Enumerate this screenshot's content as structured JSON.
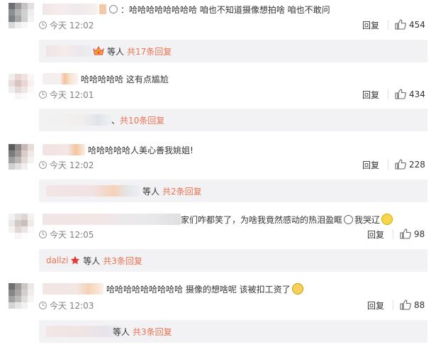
{
  "comments": [
    {
      "text": "：哈哈哈哈哈哈哈哈  咱也不知道摄像想拍啥  咱也不敢问",
      "time": "今天 12:02",
      "reply_label": "回复",
      "likes": "454",
      "sub": {
        "etc": "等人",
        "count": "共17条回复"
      }
    },
    {
      "text": "哈哈哈哈哈  这有点尴尬",
      "time": "今天 12:01",
      "reply_label": "回复",
      "likes": "434",
      "sub": {
        "etc": "、",
        "count": "共10条回复"
      }
    },
    {
      "text": "哈哈哈哈哈人美心善我姚姐!",
      "time": "今天 12:02",
      "reply_label": "回复",
      "likes": "228",
      "sub": {
        "etc": "等人",
        "count": "共2条回复"
      }
    },
    {
      "text": "家们咋都笑了，为啥我竟然感动的热泪盈眶",
      "text_tail": "我哭辽",
      "time": "今天 12:05",
      "reply_label": "回复",
      "likes": "98",
      "sub": {
        "user": "dallzi",
        "etc": "等人",
        "count": "共3条回复"
      }
    },
    {
      "text": "哈哈哈哈哈哈哈哈哈  摄像的想啥呢  该被扣工资了",
      "time": "今天 12:03",
      "reply_label": "回复",
      "likes": "88",
      "sub": {
        "etc": "等人",
        "count": "共3条回复"
      }
    }
  ],
  "colors": {
    "accent": "#eb7350",
    "muted": "#808080",
    "sub_bg": "#f2f2f5"
  },
  "icons": [
    "clock-icon",
    "thumbs-up-icon",
    "crown-icon",
    "star-icon",
    "emoji-icon"
  ]
}
